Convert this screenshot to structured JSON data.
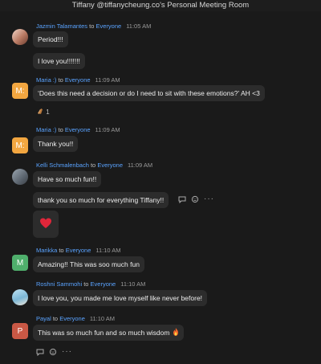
{
  "window": {
    "title": "Tiffany @tiffanycheung.co's Personal Meeting Room"
  },
  "chat": {
    "to_label": " to ",
    "m1": {
      "sender": "Jazmin Talamantes",
      "target": "Everyone",
      "time": "11:05 AM",
      "avatar": "photo",
      "lines": [
        "Period!!!",
        "I love you!!!!!!!"
      ]
    },
    "m2": {
      "sender": "Maria :)",
      "target": "Everyone",
      "time": "11:09 AM",
      "avatar_letter": "M:",
      "text": "‘Does this need a decision or do I need to sit with these emotions?’ AH <3",
      "reaction_icon": "clapping-hands-icon",
      "reaction_count": "1"
    },
    "m3": {
      "sender": "Maria :)",
      "target": "Everyone",
      "time": "11:09 AM",
      "avatar_letter": "M:",
      "text": "Thank you!!"
    },
    "m4": {
      "sender": "Kelli Schmalenbach",
      "target": "Everyone",
      "time": "11:09 AM",
      "avatar": "photo",
      "lines": [
        "Have so much fun!!",
        "thank you so much for everything Tiffany!!"
      ],
      "emoji_icon": "red-heart-icon"
    },
    "m5": {
      "sender": "Marikka",
      "target": "Everyone",
      "time": "11:10 AM",
      "avatar_letter": "M",
      "text": "Amazing!! This was soo much fun"
    },
    "m6": {
      "sender": "Roshni Sammohi",
      "target": "Everyone",
      "time": "11:10 AM",
      "avatar": "photo",
      "text": "I love you, you made me love myself like never before!"
    },
    "m7": {
      "sender": "Payal",
      "target": "Everyone",
      "time": "11:10 AM",
      "avatar_letter": "P",
      "text": "This was so much fun and so much wisdom",
      "emoji_icon": "fire-icon"
    },
    "message_tools": {
      "more_label": "···"
    }
  },
  "colors": {
    "background": "#1a1a1a",
    "bubble": "#2c2c2c",
    "sender_link": "#5aa3ff",
    "avatar_orange": "#f2a640",
    "avatar_green": "#4faf6c",
    "avatar_red": "#c95845"
  }
}
